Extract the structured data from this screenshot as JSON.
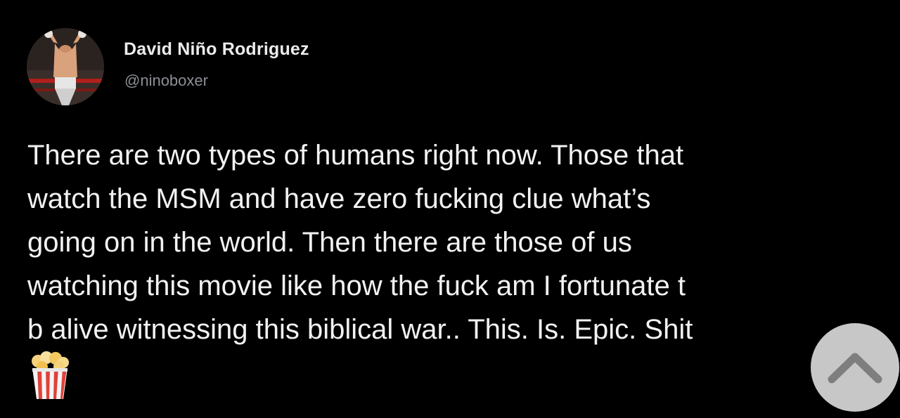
{
  "author": {
    "name": "David Niño Rodriguez",
    "handle": "@ninoboxer"
  },
  "tweet": {
    "lines": [
      "There are two types of humans right now. Those that",
      "watch the MSM and have zero fucking clue what’s",
      "going on in the world. Then there are those of us",
      "watching this movie like how the fuck am I fortunate t",
      "b alive witnessing this biblical war.. This. Is. Epic. Shit"
    ],
    "emoji": "popcorn-icon"
  },
  "controls": {
    "scroll_top_icon": "chevron-up-icon",
    "scroll_top_color": "#c7c7c7"
  }
}
